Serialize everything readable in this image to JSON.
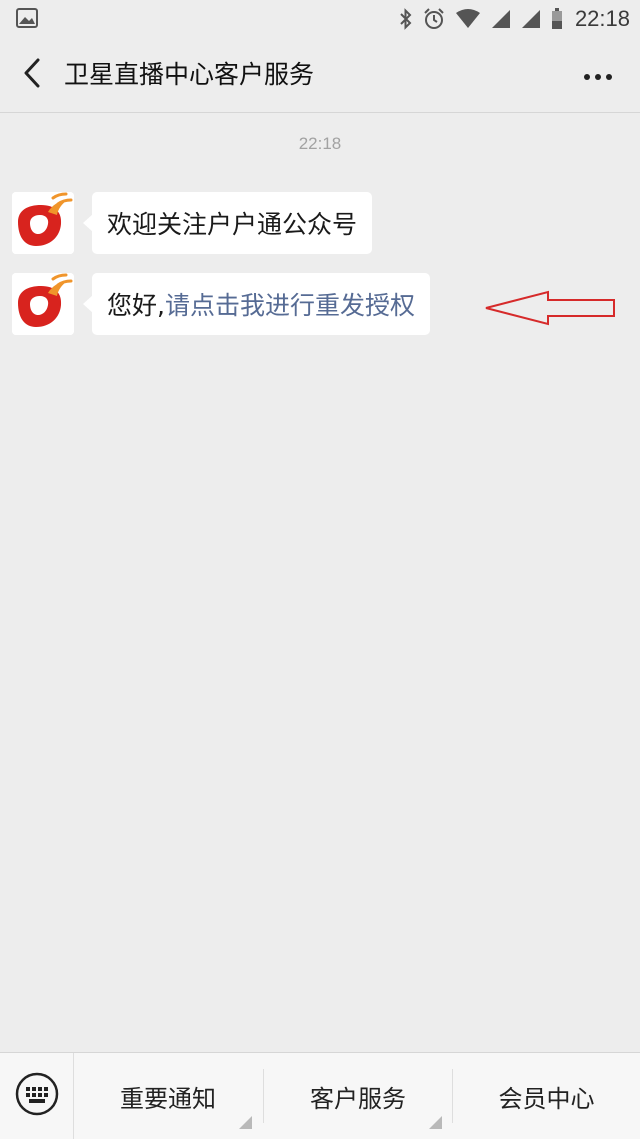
{
  "status_bar": {
    "time": "22:18",
    "icons": [
      "gallery-icon",
      "bluetooth-icon",
      "alarm-icon",
      "wifi-icon",
      "signal-icon",
      "signal-icon",
      "battery-icon"
    ]
  },
  "header": {
    "title": "卫星直播中心客户服务",
    "back_icon": "chevron-left-icon",
    "more_icon": "more-dots-icon"
  },
  "chat": {
    "timestamp": "22:18",
    "messages": [
      {
        "text": "欢迎关注户户通公众号"
      },
      {
        "prefix": "您好,",
        "link": "请点击我进行重发授权"
      }
    ]
  },
  "annotation": {
    "icon": "red-arrow-left-icon",
    "color": "#d62a2a"
  },
  "bottom_menu": {
    "keyboard_icon": "keyboard-icon",
    "items": [
      {
        "label": "重要通知"
      },
      {
        "label": "客户服务"
      },
      {
        "label": "会员中心"
      }
    ]
  },
  "colors": {
    "background": "#ededed",
    "link": "#566b94",
    "bubble": "#ffffff",
    "brand_red": "#d8231e",
    "brand_orange": "#f0952b"
  }
}
